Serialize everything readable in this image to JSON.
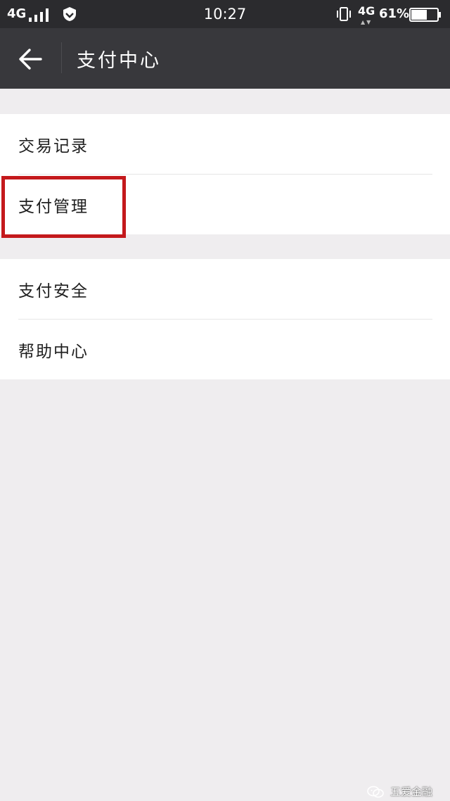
{
  "status_bar": {
    "network_left": "4G",
    "time": "10:27",
    "network_right": "4G",
    "battery_percent": "61%",
    "battery_level": 0.61
  },
  "app_bar": {
    "title": "支付中心"
  },
  "menu": {
    "group1": [
      {
        "label": "交易记录"
      },
      {
        "label": "支付管理"
      }
    ],
    "group2": [
      {
        "label": "支付安全"
      },
      {
        "label": "帮助中心"
      }
    ]
  },
  "watermark": {
    "text": "五爱金融"
  },
  "colors": {
    "status_bar_bg": "#2b2b2e",
    "app_bar_bg": "#38383c",
    "page_bg": "#efedef",
    "highlight": "#c4191c"
  }
}
